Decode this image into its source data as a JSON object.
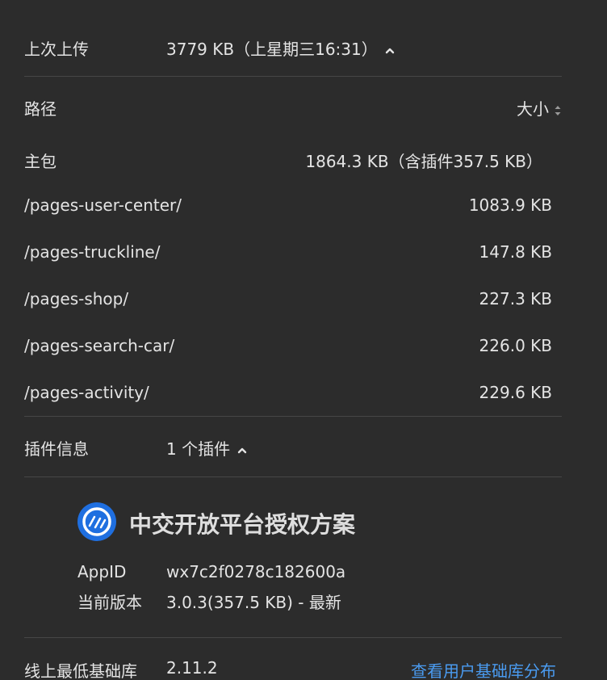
{
  "last_upload": {
    "label": "上次上传",
    "value": "3779 KB（上星期三16:31）",
    "expanded": true
  },
  "table": {
    "path_header": "路径",
    "size_header": "大小",
    "rows": [
      {
        "path": "主包",
        "size": "1864.3 KB（含插件357.5 KB）"
      },
      {
        "path": "/pages-user-center/",
        "size": "1083.9 KB"
      },
      {
        "path": "/pages-truckline/",
        "size": "147.8 KB"
      },
      {
        "path": "/pages-shop/",
        "size": "227.3 KB"
      },
      {
        "path": "/pages-search-car/",
        "size": "226.0 KB"
      },
      {
        "path": "/pages-activity/",
        "size": "229.6 KB"
      }
    ]
  },
  "plugin_info": {
    "label": "插件信息",
    "value": "1 个插件",
    "expanded": true
  },
  "plugin": {
    "name": "中交开放平台授权方案",
    "appid_label": "AppID",
    "appid_value": "wx7c2f0278c182600a",
    "version_label": "当前版本",
    "version_value": "3.0.3(357.5 KB) - 最新",
    "logo_color": "#1f6fe0"
  },
  "min_lib": {
    "label": "线上最低基础库",
    "value": "2.11.2",
    "link": "查看用户基础库分布"
  },
  "colors": {
    "background": "#2c2c2c",
    "text": "#e4e4e4",
    "link": "#4a9bf0",
    "divider": "#474747"
  },
  "icons": {
    "expand": "chevron-up-icon",
    "sort": "sort-icon",
    "plugin_logo": "plugin-logo-icon"
  }
}
